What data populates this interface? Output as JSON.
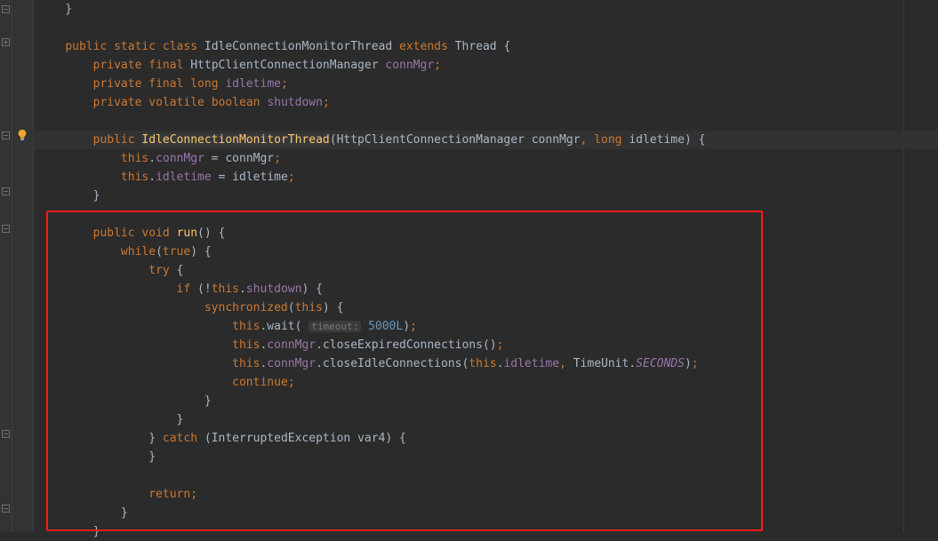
{
  "code": {
    "l0": "    }",
    "l1": "",
    "l2_kw_public": "public",
    "l2_kw_static": "static",
    "l2_kw_class": "class",
    "l2_cls": "IdleConnectionMonitorThread",
    "l2_kw_extends": "extends",
    "l2_super": "Thread",
    "l2_brace": " {",
    "l3_kw_private": "private",
    "l3_kw_final": "final",
    "l3_type": "HttpClientConnectionManager",
    "l3_fld": "connMgr",
    "l4_kw_private": "private",
    "l4_kw_final": "final",
    "l4_kw_long": "long",
    "l4_fld": "idletime",
    "l5_kw_private": "private",
    "l5_kw_volatile": "volatile",
    "l5_kw_boolean": "boolean",
    "l5_fld": "shutdown",
    "l7_kw_public": "public",
    "l7_ctor": "IdleConnectionMonitorThread",
    "l7_p1_t": "HttpClientConnectionManager",
    "l7_p1_n": "connMgr",
    "l7_kw_long": "long",
    "l7_p2_n": "idletime",
    "l8_this": "this",
    "l8_fld": "connMgr",
    "l8_rhs": "connMgr",
    "l9_this": "this",
    "l9_fld": "idletime",
    "l9_rhs": "idletime",
    "l10_brace": "}",
    "l12_kw_public": "public",
    "l12_kw_void": "void",
    "l12_mth": "run",
    "l13_kw_while": "while",
    "l13_true": "true",
    "l14_kw_try": "try",
    "l15_kw_if": "if",
    "l15_this": "this",
    "l15_fld": "shutdown",
    "l16_kw_sync": "synchronized",
    "l16_this": "this",
    "l17_this": "this",
    "l17_mth": "wait",
    "l17_hint": "timeout:",
    "l17_num": "5000L",
    "l18_this": "this",
    "l18_fld": "connMgr",
    "l18_mth": "closeExpiredConnections",
    "l19_this": "this",
    "l19_fld": "connMgr",
    "l19_mth": "closeIdleConnections",
    "l19_this2": "this",
    "l19_fld2": "idletime",
    "l19_unit": "TimeUnit",
    "l19_sec": "SECONDS",
    "l20_kw_continue": "continue",
    "l24_kw_catch": "catch",
    "l24_exc": "InterruptedException",
    "l24_var": "var4",
    "l27_kw_return": "return",
    "semicolon": ";",
    "comma": ",",
    "dot": ".",
    "open_p": "(",
    "close_p": ")",
    "open_b": "{",
    "close_b": "}",
    "bang": "!",
    "eq": " = "
  },
  "icons": {
    "bulb": "lightbulb-icon"
  },
  "highlight_annotation": "red-box"
}
